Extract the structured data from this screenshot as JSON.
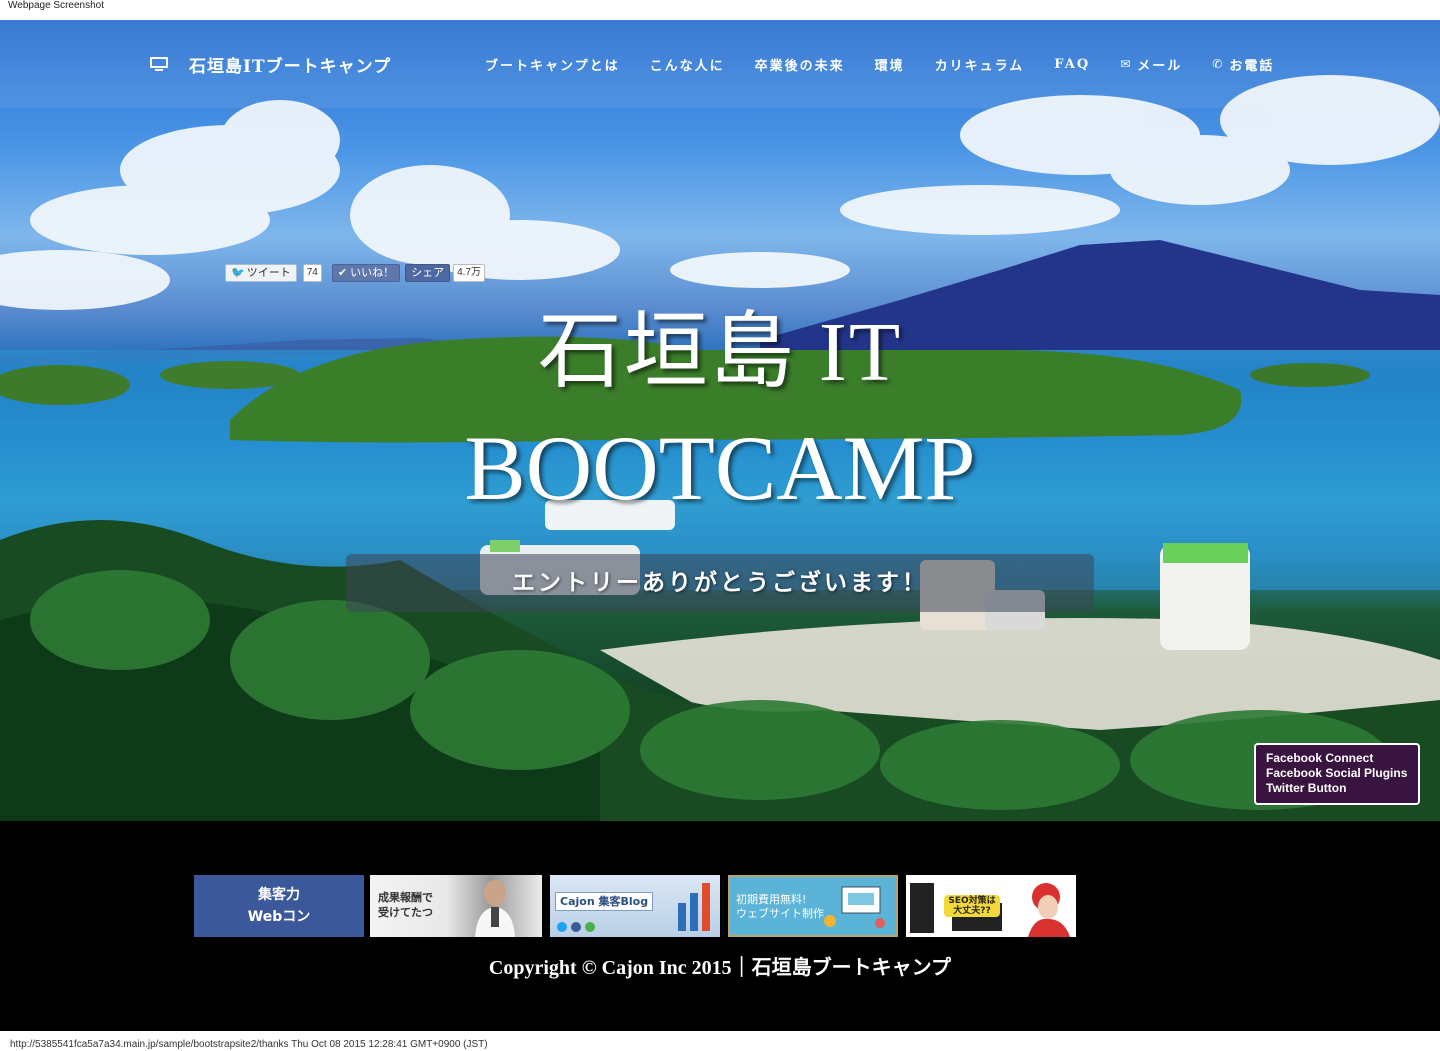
{
  "capture_label": "Webpage Screenshot",
  "brand": {
    "icon": "monitor-icon",
    "name": "石垣島ITブートキャンプ"
  },
  "nav": [
    {
      "label": "ブートキャンプとは"
    },
    {
      "label": "こんな人に"
    },
    {
      "label": "卒業後の未来"
    },
    {
      "label": "環境"
    },
    {
      "label": "カリキュラム"
    },
    {
      "label": "FAQ"
    },
    {
      "label": "メール",
      "icon": "envelope-icon",
      "glyph": "✉"
    },
    {
      "label": "お電話",
      "icon": "phone-icon",
      "glyph": "✆"
    }
  ],
  "social": {
    "tweet_label": "ツイート",
    "tweet_count": "74",
    "like_label": "いいね！",
    "share_label": "シェア",
    "share_count": "4.7万"
  },
  "hero": {
    "title_line1": "石垣島 IT",
    "title_line2": "BOOTCAMP",
    "message": "エントリーありがとうございます！"
  },
  "fb_widget": {
    "line1": "Facebook Connect",
    "line2": "Facebook Social Plugins",
    "line3": "Twitter Button"
  },
  "banners": {
    "b1_line1": "集客力",
    "b1_line2": "Webコン",
    "b2_line1": "成果報酬で",
    "b2_line2": "受けてたつ",
    "b3_text": "Cajon 集客Blog",
    "b4_line1": "初期費用無料!",
    "b4_line2": "ウェブサイト制作",
    "b5_line1": "SEO対策は",
    "b5_line2": "大丈夫??"
  },
  "footer": {
    "copyright": "Copyright © Cajon Inc 2015｜石垣島ブートキャンプ"
  },
  "status_bar": "http://5385541fca5a7a34.main.jp/sample/bootstrapsite2/thanks Thu Oct 08 2015 12:28:41 GMT+0900 (JST)",
  "colors": {
    "nav_text": "#ffffff",
    "footer_bg": "#000000",
    "facebook": "#3b589b",
    "fb_widget_bg": "#3a1440"
  }
}
